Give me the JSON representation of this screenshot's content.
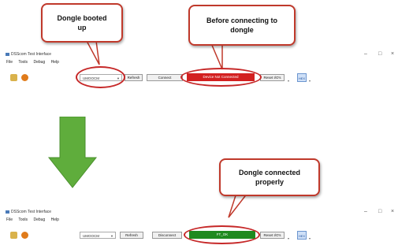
{
  "callouts": {
    "dongle_booted": "Dongle booted up",
    "before_connect": "Before connecting to dongle",
    "connected": "Dongle connected properly"
  },
  "top_window": {
    "title": "DSScom Test Interface",
    "menu": [
      "File",
      "Tools",
      "Debug",
      "Help"
    ],
    "port": "UMOOCM",
    "refresh_label": "Refresh",
    "connect_label": "Connect",
    "status_text": "Device Not Connected",
    "status_color": "#d32020",
    "reset_label": "Reset I/O's",
    "hex_label": "HEX"
  },
  "bottom_window": {
    "title": "DSScom Test Interface",
    "menu": [
      "File",
      "Tools",
      "Debug",
      "Help"
    ],
    "port": "UMOOCM",
    "refresh_label": "Refresh",
    "connect_label": "Disconnect",
    "status_text": "FT_OK",
    "status_color": "#1f8a1f",
    "reset_label": "Reset I/O's",
    "hex_label": "HEX"
  },
  "window_controls": {
    "minimize": "–",
    "maximize": "□",
    "close": "×"
  },
  "arrow_color": "#5fad3c",
  "callout_border": "#c0392b"
}
